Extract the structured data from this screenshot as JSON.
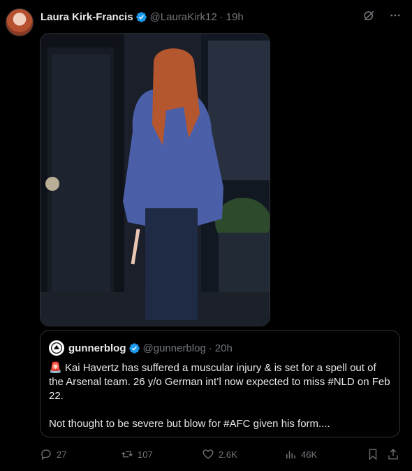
{
  "tweet": {
    "author_name": "Laura Kirk-Francis",
    "handle": "@LauraKirk12",
    "separator": "·",
    "time": "19h"
  },
  "quote": {
    "author_name": "gunnerblog",
    "handle": "@gunnerblog",
    "separator": "·",
    "time": "20h",
    "emoji": "🚨",
    "line1": "Kai Havertz has suffered a muscular injury & is set for a spell out of the Arsenal team. 26 y/o German int’l now expected to miss #NLD on Feb 22.",
    "line2": "Not thought to be severe but blow for #AFC given his form...."
  },
  "actions": {
    "replies": "27",
    "reposts": "107",
    "likes": "2.6K",
    "views": "46K"
  },
  "icons": [
    "verified-badge-icon",
    "grok-icon",
    "more-icon",
    "reply-icon",
    "repost-icon",
    "like-icon",
    "views-icon",
    "bookmark-icon",
    "share-icon"
  ],
  "colors": {
    "verified": "#1d9bf0",
    "muted": "#71767b",
    "text": "#e7e9ea",
    "border": "#2f3336"
  }
}
